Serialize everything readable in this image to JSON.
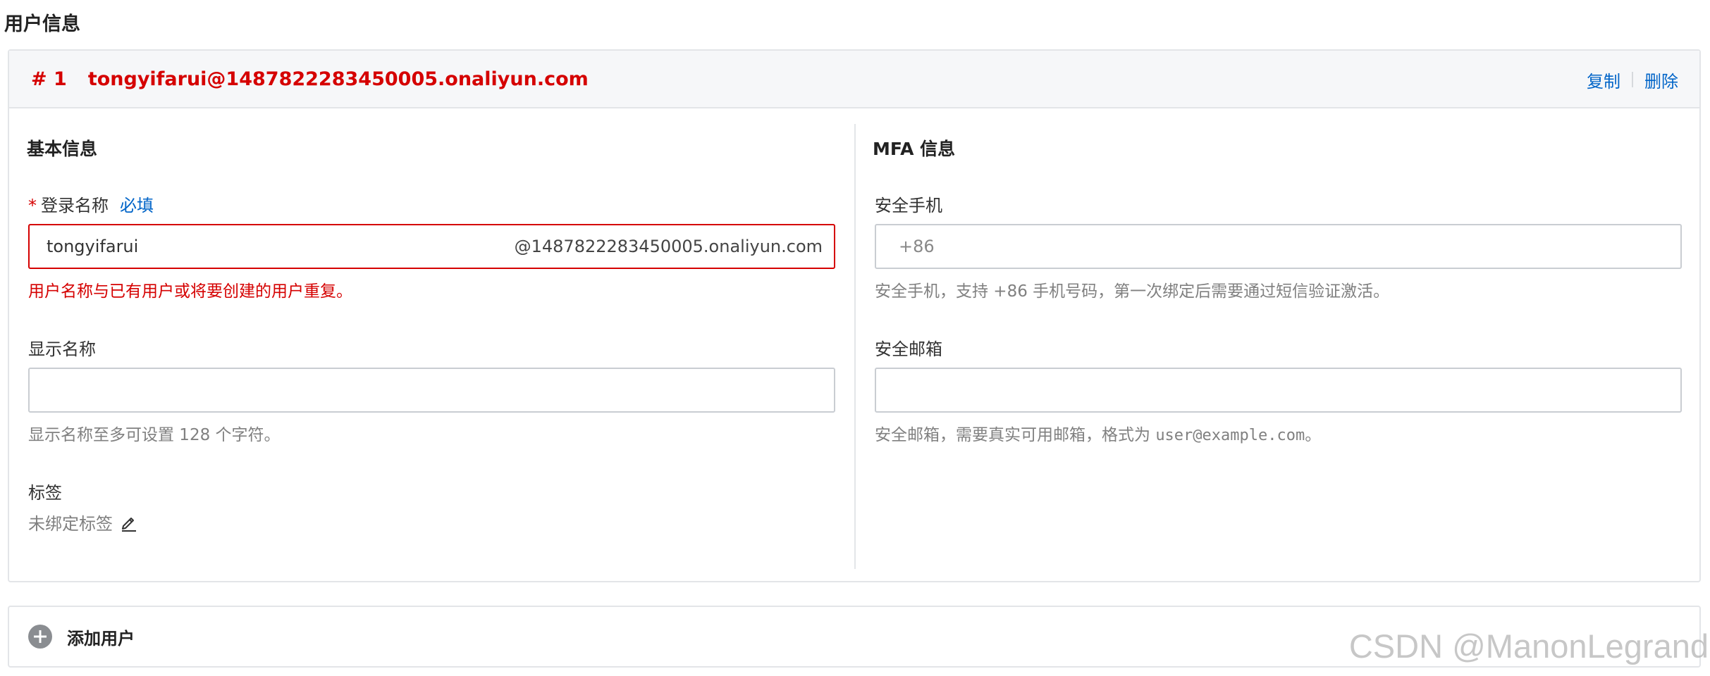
{
  "page": {
    "title": "用户信息"
  },
  "user_card": {
    "index": "# 1",
    "full_name": "tongyifarui@1487822283450005.onaliyun.com",
    "actions": {
      "copy": "复制",
      "delete": "删除"
    }
  },
  "basic": {
    "title": "基本信息",
    "login_name": {
      "star": "*",
      "label": "登录名称",
      "required": "必填",
      "value": "tongyifarui",
      "suffix": "@1487822283450005.onaliyun.com",
      "error": "用户名称与已有用户或将要创建的用户重复。"
    },
    "display_name": {
      "label": "显示名称",
      "value": "",
      "help": "显示名称至多可设置 128 个字符。"
    },
    "tags": {
      "label": "标签",
      "value": "未绑定标签"
    }
  },
  "mfa": {
    "title": "MFA 信息",
    "phone": {
      "label": "安全手机",
      "prefix": "+86",
      "value": "",
      "help": "安全手机，支持 +86 手机号码，第一次绑定后需要通过短信验证激活。"
    },
    "email": {
      "label": "安全邮箱",
      "value": "",
      "help_prefix": "安全邮箱，需要真实可用邮箱，格式为 ",
      "help_example": "user@example.com",
      "help_suffix": "。"
    }
  },
  "add_user": {
    "label": "添加用户"
  },
  "watermark": "CSDN @ManonLegrand",
  "colors": {
    "error": "#d50000",
    "link": "#0064c8",
    "border": "#c9cdd2"
  }
}
